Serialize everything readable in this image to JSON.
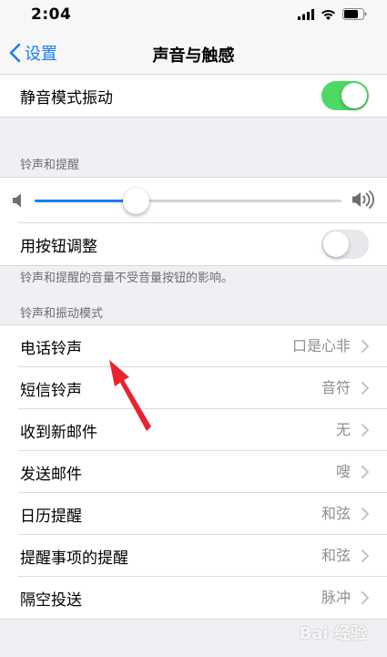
{
  "status_bar": {
    "time": "2:04"
  },
  "nav": {
    "back_label": "设置",
    "title": "声音与触感"
  },
  "silent_vibrate": {
    "label": "静音模式振动",
    "on": true
  },
  "ringer": {
    "header": "铃声和提醒",
    "volume_level": 0.33,
    "adjust_with_buttons": {
      "label": "用按钮调整",
      "on": false
    },
    "footer": "铃声和提醒的音量不受音量按钮的影响。"
  },
  "patterns": {
    "header": "铃声和振动模式",
    "items": [
      {
        "label": "电话铃声",
        "value": "口是心非"
      },
      {
        "label": "短信铃声",
        "value": "音符"
      },
      {
        "label": "收到新邮件",
        "value": "无"
      },
      {
        "label": "发送邮件",
        "value": "嗖"
      },
      {
        "label": "日历提醒",
        "value": "和弦"
      },
      {
        "label": "提醒事项的提醒",
        "value": "和弦"
      },
      {
        "label": "隔空投送",
        "value": "脉冲"
      }
    ]
  },
  "watermark": "Bai 经验",
  "colors": {
    "accent": "#1a7cf5",
    "switch_on": "#4cd964",
    "arrow": "#e8232e"
  }
}
